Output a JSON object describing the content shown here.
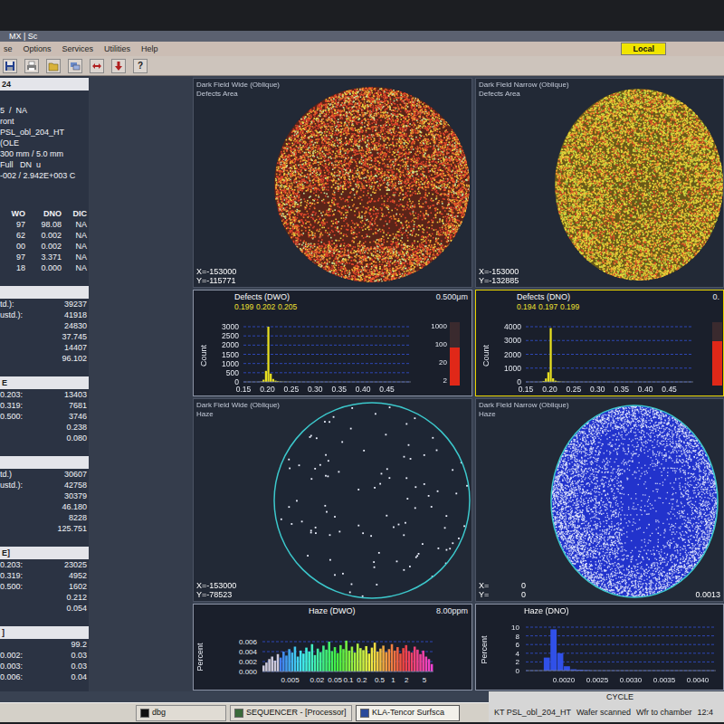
{
  "window": {
    "title": "MX | Sc"
  },
  "menu": [
    "se",
    "Options",
    "Services",
    "Utilities",
    "Help"
  ],
  "mode_badge": "Local",
  "toolbar": {
    "help": "?"
  },
  "left_panel": {
    "header": "24",
    "info": [
      "5  /  NA",
      "ront",
      "PSL_obl_204_HT",
      "(OLE",
      "300 mm / 5.0 mm",
      "Full   DN  u",
      "-002 / 2.942E+003 C"
    ],
    "table": {
      "columns": [
        "WO",
        "DNO",
        "DIC"
      ],
      "rows": [
        [
          "97",
          "98.08",
          "NA"
        ],
        [
          "62",
          "0.002",
          "NA"
        ],
        [
          "00",
          "0.002",
          "NA"
        ],
        [
          "97",
          "3.371",
          "NA"
        ],
        [
          "18",
          "0.000",
          "NA"
        ]
      ]
    },
    "sections": [
      {
        "header": "",
        "rows": [
          [
            "td.):",
            "39237"
          ],
          [
            "ustd.):",
            "41918"
          ],
          [
            "",
            "24830"
          ],
          [
            "",
            "37.745"
          ],
          [
            "",
            "14407"
          ],
          [
            "",
            "96.102"
          ]
        ]
      },
      {
        "header": "E",
        "rows": [
          [
            "0.203:",
            "13403"
          ],
          [
            "0.319:",
            "7681"
          ],
          [
            "0.500:",
            "3746"
          ],
          [
            "",
            "0.238"
          ],
          [
            "",
            "0.080"
          ]
        ]
      },
      {
        "header": "",
        "rows": [
          [
            "td.)",
            "30607"
          ],
          [
            "ustd.):",
            "42758"
          ],
          [
            "",
            "30379"
          ],
          [
            "",
            "46.180"
          ],
          [
            "",
            "8228"
          ],
          [
            "",
            "125.751"
          ]
        ]
      },
      {
        "header": "E]",
        "rows": [
          [
            "0.203:",
            "23025"
          ],
          [
            "0.319:",
            "4952"
          ],
          [
            "0.500:",
            "1602"
          ],
          [
            "",
            "0.212"
          ],
          [
            "",
            "0.054"
          ]
        ]
      },
      {
        "header": "]",
        "rows": [
          [
            "",
            "99.2"
          ],
          [
            "0.002:",
            "0.03"
          ],
          [
            "0.003:",
            "0.03"
          ],
          [
            "0.006:",
            "0.04"
          ]
        ]
      }
    ]
  },
  "maps": [
    {
      "title": "Dark Field Wide (Oblique)",
      "subtitle": "Defects Area",
      "kind": "defect",
      "x": "X=-153000",
      "y": "Y=-115771",
      "base": "#5a2418",
      "colors": [
        "#e0442c",
        "#f08a2a",
        "#f0d040",
        "#c8e8a0"
      ]
    },
    {
      "title": "Dark Field Narrow (Oblique)",
      "subtitle": "Defects Area",
      "kind": "defect",
      "x": "X=-153000",
      "y": "Y=-132885",
      "base": "#6a5a18",
      "colors": [
        "#e6d83a",
        "#f0a030",
        "#d84a28",
        "#a8d048"
      ]
    },
    {
      "title": "Dark Field Wide (Oblique)",
      "subtitle": "Haze",
      "kind": "haze_sparse",
      "x": "X=-153000",
      "y": "Y=-78523",
      "base": "#1e2634",
      "colors": [
        "#eef2ff"
      ]
    },
    {
      "title": "Dark Field Narrow (Oblique)",
      "subtitle": "Haze",
      "kind": "haze_dense",
      "x": "X=",
      "y": "Y=",
      "x_value": "0",
      "y_value": "0",
      "corner": "0.0013",
      "base": "#2233cc",
      "colors": [
        "#e8ecff"
      ]
    }
  ],
  "defect_histograms": [
    {
      "title": "Defects (DWO)",
      "cursor": [
        "0.199",
        "0.202",
        "0.205"
      ],
      "unit": "0.500μm",
      "y_label": "Count",
      "y_ticks": [
        "3000",
        "2500",
        "2000",
        "1500",
        "1000",
        "500",
        "0"
      ],
      "x_ticks": [
        "0.15",
        "0.20",
        "0.25",
        "0.30",
        "0.35",
        "0.40",
        "0.45"
      ],
      "values": [
        0,
        0,
        0,
        0,
        0,
        0,
        5,
        20,
        120,
        600,
        3000,
        450,
        160,
        70,
        35,
        20,
        12,
        8,
        6,
        4,
        3,
        3,
        2,
        2,
        2,
        1,
        1,
        1,
        1,
        1,
        1,
        1,
        1,
        0,
        1,
        0,
        0,
        1,
        0,
        0,
        0,
        0,
        0,
        0,
        0,
        0,
        0,
        0,
        0,
        0,
        0,
        0,
        0,
        0,
        0,
        0,
        0,
        0,
        0,
        0,
        0,
        0,
        0,
        0,
        0,
        0,
        0,
        0,
        0,
        0
      ],
      "log_ticks": [
        "1000",
        "100",
        "20",
        "2"
      ],
      "scale_level": 0.6,
      "selected": false
    },
    {
      "title": "Defects (DNO)",
      "cursor": [
        "0.194",
        "0.197",
        "0.199"
      ],
      "unit": "0.",
      "y_label": "Count",
      "y_ticks": [
        "4000",
        "3000",
        "2000",
        "1000",
        "0"
      ],
      "x_ticks": [
        "0.15",
        "0.20",
        "0.25",
        "0.30",
        "0.35",
        "0.40",
        "0.45"
      ],
      "values": [
        0,
        0,
        0,
        0,
        0,
        0,
        10,
        60,
        250,
        700,
        3900,
        260,
        90,
        40,
        20,
        10,
        6,
        4,
        3,
        2,
        2,
        1,
        1,
        1,
        1,
        0,
        0,
        0,
        0,
        0,
        0,
        0,
        0,
        0,
        0,
        0,
        0,
        0,
        0,
        0,
        0,
        0,
        0,
        0,
        0,
        0,
        0,
        0,
        0,
        0,
        0,
        0,
        0,
        0,
        0,
        0,
        0,
        0,
        0,
        0,
        0,
        0,
        0,
        0,
        0,
        0,
        0,
        0,
        0,
        0
      ],
      "log_ticks": [],
      "scale_level": 0.7,
      "selected": true
    }
  ],
  "haze_histograms": [
    {
      "title": "Haze (DWO)",
      "unit": "8.00ppm",
      "kind": "log",
      "y_label": "Percent",
      "y_ticks": [
        "0.006",
        "0.004",
        "0.002",
        "0.000"
      ],
      "x_ticks": [
        "0.005",
        "0.02",
        "0.05",
        "0.1",
        "0.2",
        "0.5",
        "1",
        "2",
        "5"
      ],
      "values": [
        0.0012,
        0.0018,
        0.0025,
        0.003,
        0.0022,
        0.0035,
        0.0028,
        0.004,
        0.0032,
        0.0045,
        0.0038,
        0.005,
        0.003,
        0.0042,
        0.0036,
        0.0048,
        0.004,
        0.0055,
        0.0033,
        0.0046,
        0.0039,
        0.0052,
        0.0044,
        0.006,
        0.0041,
        0.0049,
        0.0037,
        0.0053,
        0.0045,
        0.0062,
        0.0042,
        0.005,
        0.0038,
        0.0056,
        0.0047,
        0.0043,
        0.0051,
        0.0036,
        0.0048,
        0.0058,
        0.004,
        0.0046,
        0.0052,
        0.0039,
        0.0045,
        0.0055,
        0.0042,
        0.0049,
        0.0036,
        0.0047,
        0.0053,
        0.0041,
        0.0038,
        0.005,
        0.0044,
        0.0035,
        0.0042,
        0.003,
        0.0025,
        0.0015
      ]
    },
    {
      "title": "Haze (DNO)",
      "unit": "",
      "kind": "linear",
      "y_label": "Percent",
      "y_ticks": [
        "10",
        "8",
        "6",
        "4",
        "2",
        "0"
      ],
      "x_ticks": [
        "0.0020",
        "0.0025",
        "0.0030",
        "0.0035",
        "0.0040"
      ],
      "values": [
        0,
        0,
        3,
        9.5,
        4,
        1,
        0.3,
        0.2,
        0.1,
        0,
        0,
        0,
        0,
        0,
        0,
        0,
        0,
        0,
        0,
        0,
        0,
        0,
        0,
        0,
        0,
        0,
        0
      ]
    }
  ],
  "status_bar": {
    "cycle": "CYCLE",
    "recipe": "KT PSL_obl_204_HT",
    "state": "Wafer scanned",
    "next": "Wfr to chamber",
    "time": "12:4"
  },
  "taskbar": [
    {
      "label": "dbg",
      "selected": false
    },
    {
      "label": "SEQUENCER - [Processor]",
      "selected": false
    },
    {
      "label": "KLA-Tencor Surfsca",
      "selected": true
    }
  ]
}
